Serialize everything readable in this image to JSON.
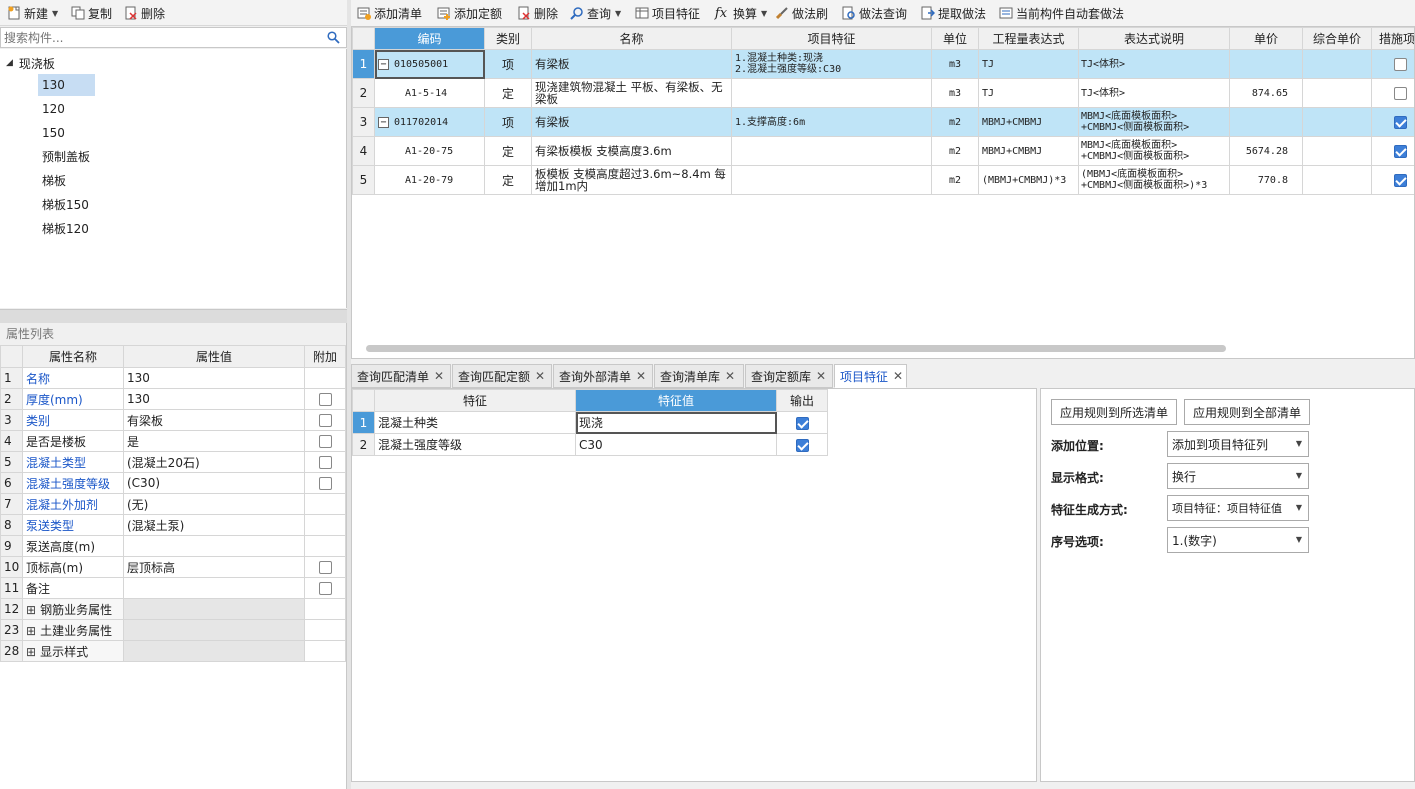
{
  "left_toolbar": {
    "new_label": "新建",
    "copy_label": "复制",
    "delete_label": "删除"
  },
  "search": {
    "placeholder": "搜索构件..."
  },
  "tree": {
    "root": "现浇板",
    "children": [
      "130",
      "120",
      "150",
      "预制盖板",
      "梯板",
      "梯板150",
      "梯板120"
    ],
    "selected_index": 0
  },
  "props": {
    "panel_title": "属性列表",
    "headers": [
      "属性名称",
      "属性值",
      "附加"
    ],
    "rows": [
      {
        "num": "1",
        "name": "名称",
        "value": "130",
        "blue": true,
        "check": "none"
      },
      {
        "num": "2",
        "name": "厚度(mm)",
        "value": "130",
        "blue": true,
        "check": "off"
      },
      {
        "num": "3",
        "name": "类别",
        "value": "有梁板",
        "blue": true,
        "check": "off"
      },
      {
        "num": "4",
        "name": "是否是楼板",
        "value": "是",
        "blue": false,
        "check": "off"
      },
      {
        "num": "5",
        "name": "混凝土类型",
        "value": "(混凝土20石)",
        "blue": true,
        "check": "off"
      },
      {
        "num": "6",
        "name": "混凝土强度等级",
        "value": "(C30)",
        "blue": true,
        "check": "off"
      },
      {
        "num": "7",
        "name": "混凝土外加剂",
        "value": "(无)",
        "blue": true,
        "check": "none"
      },
      {
        "num": "8",
        "name": "泵送类型",
        "value": "(混凝土泵)",
        "blue": true,
        "check": "none"
      },
      {
        "num": "9",
        "name": "泵送高度(m)",
        "value": "",
        "blue": false,
        "check": "none"
      },
      {
        "num": "10",
        "name": "顶标高(m)",
        "value": "层顶标高",
        "blue": false,
        "check": "off"
      },
      {
        "num": "11",
        "name": "备注",
        "value": "",
        "blue": false,
        "check": "off"
      },
      {
        "num": "12",
        "name": "钢筋业务属性",
        "value": "",
        "blue": false,
        "check": "none",
        "group": true
      },
      {
        "num": "23",
        "name": "土建业务属性",
        "value": "",
        "blue": false,
        "check": "none",
        "group": true
      },
      {
        "num": "28",
        "name": "显示样式",
        "value": "",
        "blue": false,
        "check": "none",
        "group": true
      }
    ]
  },
  "main_toolbar": {
    "add_list": "添加清单",
    "add_quota": "添加定额",
    "delete": "删除",
    "query": "查询",
    "item_feature": "项目特征",
    "convert": "换算",
    "method_brush": "做法刷",
    "method_query": "做法查询",
    "extract_method": "提取做法",
    "auto_method": "当前构件自动套做法"
  },
  "grid": {
    "headers": [
      "编码",
      "类别",
      "名称",
      "项目特征",
      "单位",
      "工程量表达式",
      "表达式说明",
      "单价",
      "综合单价",
      "措施项"
    ],
    "rows": [
      {
        "num": "1",
        "code": "010505001",
        "type": "项",
        "name": "有梁板",
        "feature": "1.混凝土种类:现浇\n2.混凝土强度等级:C30",
        "unit": "m3",
        "expr": "TJ",
        "desc": "TJ<体积>",
        "price": "",
        "total": "",
        "measure": false,
        "level": 0,
        "highlight": true
      },
      {
        "num": "2",
        "code": "A1-5-14",
        "type": "定",
        "name": "现浇建筑物混凝土 平板、有梁板、无梁板",
        "feature": "",
        "unit": "m3",
        "expr": "TJ",
        "desc": "TJ<体积>",
        "price": "874.65",
        "total": "",
        "measure": false,
        "level": 1,
        "highlight": false
      },
      {
        "num": "3",
        "code": "011702014",
        "type": "项",
        "name": "有梁板",
        "feature": "1.支撑高度:6m",
        "unit": "m2",
        "expr": "MBMJ+CMBMJ",
        "desc": "MBMJ<底面模板面积>\n+CMBMJ<侧面模板面积>",
        "price": "",
        "total": "",
        "measure": true,
        "level": 0,
        "highlight": true
      },
      {
        "num": "4",
        "code": "A1-20-75",
        "type": "定",
        "name": "有梁板模板 支模高度3.6m",
        "feature": "",
        "unit": "m2",
        "expr": "MBMJ+CMBMJ",
        "desc": "MBMJ<底面模板面积>\n+CMBMJ<侧面模板面积>",
        "price": "5674.28",
        "total": "",
        "measure": true,
        "level": 1,
        "highlight": false
      },
      {
        "num": "5",
        "code": "A1-20-79",
        "type": "定",
        "name": "板模板 支模高度超过3.6m~8.4m 每增加1m内",
        "feature": "",
        "unit": "m2",
        "expr": "(MBMJ+CMBMJ)*3",
        "desc": "(MBMJ<底面模板面积>\n+CMBMJ<侧面模板面积>)*3",
        "price": "770.8",
        "total": "",
        "measure": true,
        "level": 1,
        "highlight": false
      }
    ]
  },
  "bottom_tabs": [
    "查询匹配清单",
    "查询匹配定额",
    "查询外部清单",
    "查询清单库",
    "查询定额库",
    "项目特征"
  ],
  "features": {
    "headers": [
      "特征",
      "特征值",
      "输出"
    ],
    "rows": [
      {
        "num": "1",
        "name": "混凝土种类",
        "value": "现浇",
        "output": true
      },
      {
        "num": "2",
        "name": "混凝土强度等级",
        "value": "C30",
        "output": true
      }
    ]
  },
  "rules": {
    "apply_selected": "应用规则到所选清单",
    "apply_all": "应用规则到全部清单",
    "add_position_label": "添加位置:",
    "add_position_value": "添加到项目特征列",
    "display_format_label": "显示格式:",
    "display_format_value": "换行",
    "gen_mode_label": "特征生成方式:",
    "gen_mode_value": "项目特征：项目特征值",
    "seq_label": "序号选项:",
    "seq_value": "1.(数字)"
  },
  "colors": {
    "accent": "#3d7fd8",
    "row_highlight": "#bfe4f7",
    "header_active": "#4a9ad8"
  }
}
